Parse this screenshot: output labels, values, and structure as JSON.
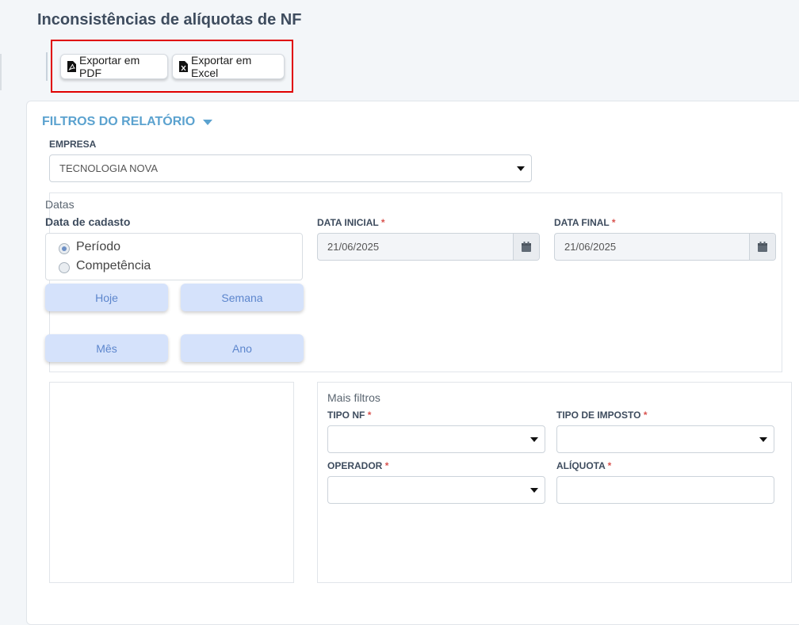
{
  "page": {
    "title": "Inconsistências de alíquotas de NF"
  },
  "toolbar": {
    "export_pdf_label": "Exportar em PDF",
    "export_excel_label": "Exportar em Excel"
  },
  "filters": {
    "section_title": "FILTROS DO RELATÓRIO",
    "empresa": {
      "label": "EMPRESA",
      "value": "TECNOLOGIA NOVA"
    },
    "dates": {
      "group_title": "Datas",
      "date_type_label": "Data de cadasto",
      "options": [
        "Período",
        "Competência"
      ],
      "selected": "Período",
      "quick_buttons": [
        "Hoje",
        "Semana",
        "Mês",
        "Ano"
      ],
      "start": {
        "label": "DATA INICIAL",
        "required_mark": "*",
        "value": "21/06/2025"
      },
      "end": {
        "label": "DATA FINAL",
        "required_mark": "*",
        "value": "21/06/2025"
      }
    },
    "more": {
      "title": "Mais filtros",
      "tipo_nf": {
        "label": "TIPO NF",
        "required_mark": "*",
        "value": ""
      },
      "tipo_imposto": {
        "label": "TIPO DE IMPOSTO",
        "required_mark": "*",
        "value": ""
      },
      "operador": {
        "label": "OPERADOR",
        "required_mark": "*",
        "value": ""
      },
      "aliquota": {
        "label": "ALÍQUOTA",
        "required_mark": "*",
        "value": ""
      }
    }
  },
  "icons": {
    "pdf": "file-pdf-icon",
    "excel": "file-excel-icon",
    "calendar": "calendar-icon",
    "dropdown": "caret-down-icon"
  },
  "colors": {
    "accent": "#5ba2cf",
    "highlight_border": "#e00000",
    "quick_button_bg": "#d5e2fb",
    "quick_button_text": "#5d86cd",
    "required": "#d9534f"
  }
}
